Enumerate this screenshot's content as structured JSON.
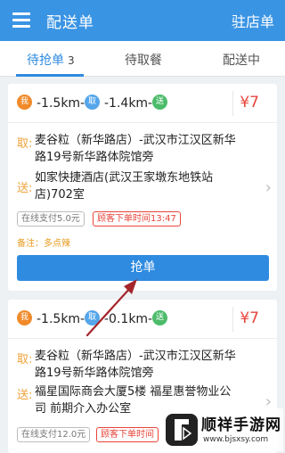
{
  "header": {
    "title": "配送单",
    "right_label": "驻店单"
  },
  "tabs": [
    {
      "label": "待抢单",
      "count": "3"
    },
    {
      "label": "待取餐"
    },
    {
      "label": "配送中"
    }
  ],
  "orders": [
    {
      "badges": {
        "me": "我",
        "pickup": "取",
        "deliver": "送"
      },
      "dist_me_to_pickup": "-1.5km-",
      "dist_pickup_to_deliver": "-1.4km-",
      "price": "¥7",
      "pickup_label": "取:",
      "pickup_line1": "麦谷粒（新华路店）-武汉市江汉区新华",
      "pickup_line2": "路19号新华路体院馆旁",
      "deliver_label": "送:",
      "deliver_line1": "如家快捷酒店(武汉王家墩东地铁站",
      "deliver_line2": "店)702室",
      "tag_paid": "在线支付5.0元",
      "tag_time": "顾客下单时间13:47",
      "remark": "备注：多点辣",
      "grab_label": "抢单"
    },
    {
      "badges": {
        "me": "我",
        "pickup": "取",
        "deliver": "送"
      },
      "dist_me_to_pickup": "-1.5km-",
      "dist_pickup_to_deliver": "-0.1km-",
      "price": "¥7",
      "pickup_label": "取:",
      "pickup_line1": "麦谷粒（新华路店）-武汉市江汉区新华",
      "pickup_line2": "路19号新华路体院馆旁",
      "deliver_label": "送:",
      "deliver_line1": "福星国际商会大厦5楼 福星惠誉物业公",
      "deliver_line2": "司 前期介入办公室",
      "tag_paid": "在线支付12.0元",
      "tag_time": "顾客下单时间"
    }
  ],
  "watermark": {
    "title": "顺祥手游网",
    "url": "www.bjsxsy.com"
  },
  "colors": {
    "primary": "#2f8be0",
    "topbar": "#3a94e4",
    "price": "#e7453b",
    "accent_orange": "#f0a23a",
    "annotation_arrow": "#a4262c"
  }
}
